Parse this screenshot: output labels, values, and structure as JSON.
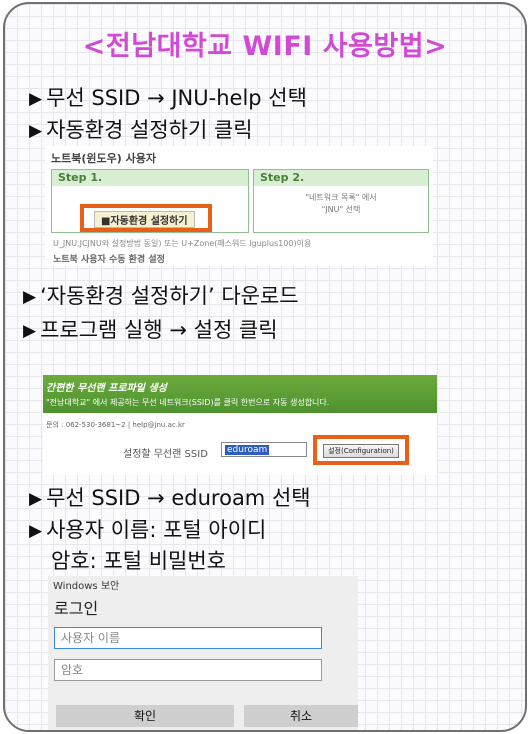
{
  "title": "<전남대학교 WIFI 사용방법>",
  "steps": {
    "s1": "무선 SSID → JNU-help 선택",
    "s2": "자동환경 설정하기 클릭",
    "s3": "‘자동환경 설정하기’ 다운로드",
    "s4": "프로그램 실행 → 설정 클릭",
    "s5": "무선 SSID → eduroam 선택",
    "s6": "사용자 이름: 포털 아이디",
    "s7": "암호: 포털 비밀번호"
  },
  "shot1": {
    "header": "노트북(윈도우) 사용자",
    "step1_label": "Step 1.",
    "step2_label": "Step 2.",
    "step2_line1": "\"네트워크 목록\" 에서",
    "step2_line2": "\"JNU\" 선택",
    "button_label": "■자동환경 설정하기",
    "footnote": "U_JNU,JCJNU와 설정방법 동일) 또는 U+Zone(패스워드 lguplus100)이용",
    "footer": "노트북 사용자 수동 환경 설정"
  },
  "shot2": {
    "green_title": "간편한 무선랜 프로파일 생성",
    "green_sub": "\"전남대학교\" 에서 제공하는 무선 네트워크(SSID)를 클릭 한번으로 자동 생성합니다.",
    "contact": "문의 : 062-530-3681~2  |  help@jnu.ac.kr",
    "ssid_label": "설정할 무선랜 SSID",
    "ssid_value": "eduroam",
    "config_button": "설정(Configuration)"
  },
  "login": {
    "window_label": "Windows 보안",
    "title": "로그인",
    "username_placeholder": "사용자 이름",
    "password_placeholder": "암호",
    "ok": "확인",
    "cancel": "취소"
  },
  "colors": {
    "title": "#d14ad6",
    "highlight": "#e85f18",
    "green_bar": "#5a9e35"
  }
}
